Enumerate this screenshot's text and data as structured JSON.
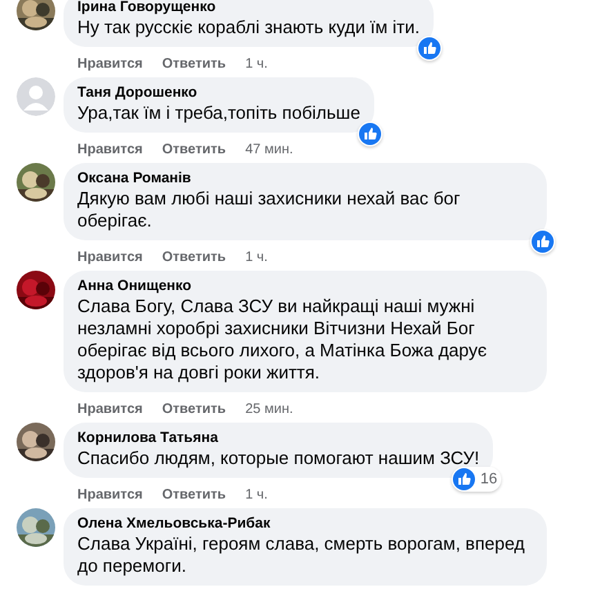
{
  "comments": [
    {
      "author": "Ірина Говорущенко",
      "text": "Ну так русскіє кораблі знають куди їм іти.",
      "actions": [
        "Нравится",
        "Ответить"
      ],
      "time": "1 ч.",
      "reaction": {
        "kind": "like"
      }
    },
    {
      "author": "Таня Дорошенко",
      "text": "Ура,так їм і треба,топіть побільше",
      "avatar": {
        "kind": "default"
      },
      "actions": [
        "Нравится",
        "Ответить"
      ],
      "time": "47 мин.",
      "reaction": {
        "kind": "like"
      }
    },
    {
      "author": "Оксана Романів",
      "text": "Дякую вам любі наші захисники нехай вас бог оберігає.",
      "actions": [
        "Нравится",
        "Ответить"
      ],
      "time": "1 ч.",
      "reaction": {
        "kind": "like"
      }
    },
    {
      "author": "Анна Онищенко",
      "text": "Слава Богу, Слава ЗСУ ви найкращі наші мужні незламні хоробрі захисники Вітчизни Нехай Бог оберігає від всього лихого, а Матінка Божа дарує здоров'я на довгі роки життя.",
      "actions": [
        "Нравится",
        "Ответить"
      ],
      "time": "25 мин."
    },
    {
      "author": "Корнилова Татьяна",
      "text": "Спасибо людям, которые помогают нашим ЗСУ!",
      "actions": [
        "Нравится",
        "Ответить"
      ],
      "time": "1 ч.",
      "reaction": {
        "kind": "like",
        "count": "16"
      }
    },
    {
      "author": "Олена Хмельовська-Рибак",
      "text": "Слава Україні, героям слава, смерть ворогам, вперед до перемоги."
    }
  ]
}
